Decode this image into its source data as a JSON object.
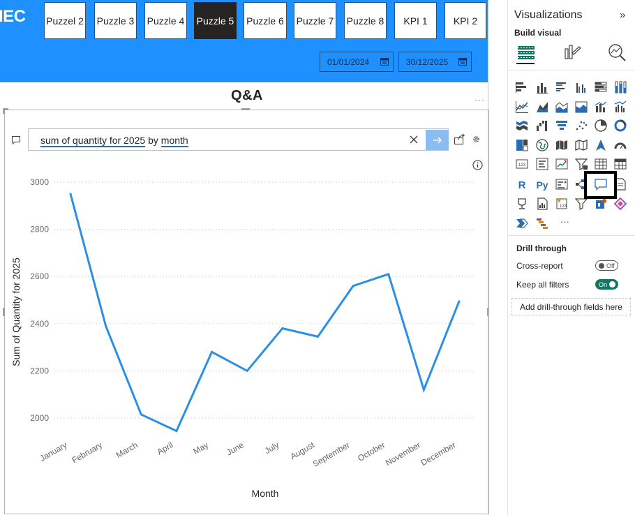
{
  "report": {
    "brand_fragment": "IEC",
    "nav_buttons": [
      {
        "label": "Puzzel 2",
        "active": false
      },
      {
        "label": "Puzzle 3",
        "active": false
      },
      {
        "label": "Puzzle 4",
        "active": false
      },
      {
        "label": "Puzzle 5",
        "active": true
      },
      {
        "label": "Puzzle 6",
        "active": false
      },
      {
        "label": "Puzzle 7",
        "active": false
      },
      {
        "label": "Puzzle 8",
        "active": false
      },
      {
        "label": "KPI 1",
        "active": false
      },
      {
        "label": "KPI 2",
        "active": false
      }
    ],
    "date_start": "01/01/2024",
    "date_end": "30/12/2025",
    "visual_title": "Q&A",
    "more_options": "···",
    "qa": {
      "query_part1": "sum of quantity for 2025",
      "query_joiner": " by ",
      "query_part2": "month"
    }
  },
  "chart_data": {
    "type": "line",
    "categories": [
      "January",
      "February",
      "March",
      "April",
      "May",
      "June",
      "July",
      "August",
      "September",
      "October",
      "November",
      "December"
    ],
    "series": [
      {
        "values": [
          2950,
          2390,
          2015,
          1945,
          2280,
          2200,
          2380,
          2345,
          2560,
          2610,
          2120,
          2495
        ]
      }
    ],
    "xlabel": "Month",
    "ylabel": "Sum of Quantity for 2025",
    "yticks": [
      2000,
      2200,
      2400,
      2600,
      2800,
      3000
    ],
    "ylim": [
      1900,
      3040
    ],
    "grid": true,
    "line_color": "#2b8fe3"
  },
  "pane": {
    "title": "Visualizations",
    "collapse_glyph": "»",
    "build_label": "Build visual",
    "more_visuals": "···",
    "drill": {
      "title": "Drill through",
      "cross_report_label": "Cross-report",
      "cross_report_state": "Off",
      "keep_filters_label": "Keep all filters",
      "keep_filters_state": "On",
      "add_fields": "Add drill-through fields here"
    }
  },
  "colors": {
    "header_blue": "#1e90ff",
    "active_button": "#252423",
    "qa_submit": "#8bbcf0",
    "toggle_on": "#117865"
  }
}
